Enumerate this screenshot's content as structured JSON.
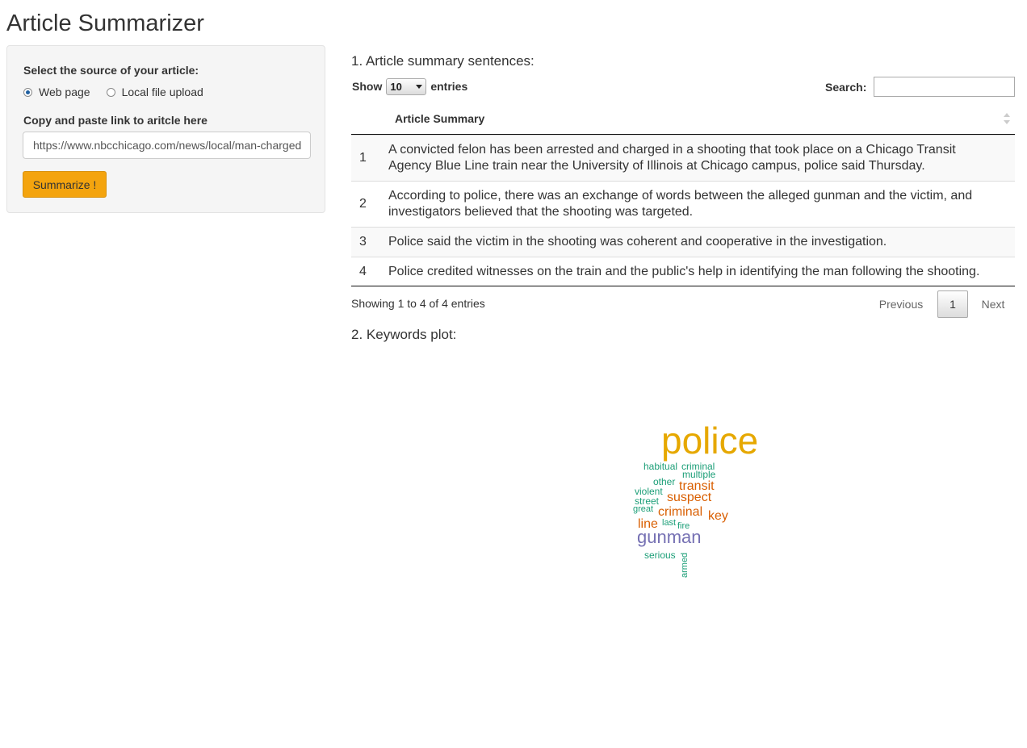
{
  "app": {
    "title": "Article Summarizer"
  },
  "sidebar": {
    "source_label": "Select the source of your article:",
    "source_options": [
      {
        "label": "Web page",
        "selected": true
      },
      {
        "label": "Local file upload",
        "selected": false
      }
    ],
    "link_label": "Copy and paste link to aritcle here",
    "link_value": "https://www.nbcchicago.com/news/local/man-charged",
    "summarize_label": "Summarize !",
    "summarize_color": "#f4a40e"
  },
  "summary_section": {
    "heading": "1. Article summary sentences:",
    "show_label": "Show",
    "page_length": "10",
    "entries_label": "entries",
    "search_label": "Search:",
    "search_value": "",
    "column_header": "Article Summary",
    "rows": [
      {
        "index": "1",
        "text": "A convicted felon has been arrested and charged in a shooting that took place on a Chicago Transit Agency Blue Line train near the University of Illinois at Chicago campus, police said Thursday."
      },
      {
        "index": "2",
        "text": "According to police, there was an exchange of words between the alleged gunman and the victim, and investigators believed that the shooting was targeted."
      },
      {
        "index": "3",
        "text": "Police said the victim in the shooting was coherent and cooperative in the investigation."
      },
      {
        "index": "4",
        "text": "Police credited witnesses on the train and the public's help in identifying the man following the shooting."
      }
    ],
    "info": "Showing 1 to 4 of 4 entries",
    "pagination": {
      "previous": "Previous",
      "current": "1",
      "next": "Next"
    }
  },
  "keywords_section": {
    "heading": "2. Keywords plot:",
    "words": [
      {
        "text": "police",
        "color": "#e6a800"
      },
      {
        "text": "habitual",
        "color": "#1b9e77"
      },
      {
        "text": "criminal",
        "color": "#1b9e77"
      },
      {
        "text": "multiple",
        "color": "#1b9e77"
      },
      {
        "text": "other",
        "color": "#1b9e77"
      },
      {
        "text": "transit",
        "color": "#d95f02"
      },
      {
        "text": "violent",
        "color": "#1b9e77"
      },
      {
        "text": "suspect",
        "color": "#d95f02"
      },
      {
        "text": "street",
        "color": "#1b9e77"
      },
      {
        "text": "great",
        "color": "#1b9e77"
      },
      {
        "text": "criminal",
        "color": "#d95f02"
      },
      {
        "text": "key",
        "color": "#d95f02"
      },
      {
        "text": "line",
        "color": "#d95f02"
      },
      {
        "text": "last",
        "color": "#1b9e77"
      },
      {
        "text": "fire",
        "color": "#1b9e77"
      },
      {
        "text": "gunman",
        "color": "#7570b3"
      },
      {
        "text": "serious",
        "color": "#1b9e77"
      },
      {
        "text": "armed",
        "color": "#1b9e77"
      }
    ]
  }
}
